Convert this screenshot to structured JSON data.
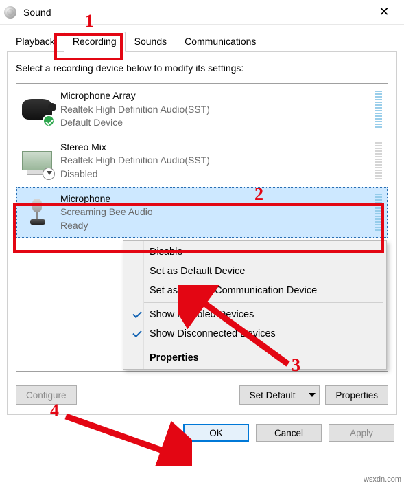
{
  "window": {
    "title": "Sound"
  },
  "tabs": {
    "playback": "Playback",
    "recording": "Recording",
    "sounds": "Sounds",
    "communications": "Communications",
    "active": "Recording"
  },
  "panel": {
    "instruction": "Select a recording device below to modify its settings:"
  },
  "devices": [
    {
      "name": "Microphone Array",
      "driver": "Realtek High Definition Audio(SST)",
      "state": "Default Device"
    },
    {
      "name": "Stereo Mix",
      "driver": "Realtek High Definition Audio(SST)",
      "state": "Disabled"
    },
    {
      "name": "Microphone",
      "driver": "Screaming Bee Audio",
      "state": "Ready"
    }
  ],
  "context_menu": {
    "disable": "Disable",
    "set_default": "Set as Default Device",
    "set_default_comm": "Set as Default Communication Device",
    "show_disabled": "Show Disabled Devices",
    "show_disconnected": "Show Disconnected Devices",
    "properties": "Properties"
  },
  "buttons": {
    "configure": "Configure",
    "set_default": "Set Default",
    "properties": "Properties",
    "ok": "OK",
    "cancel": "Cancel",
    "apply": "Apply"
  },
  "annotations": {
    "n1": "1",
    "n2": "2",
    "n3": "3",
    "n4": "4"
  },
  "watermark": "wsxdn.com"
}
